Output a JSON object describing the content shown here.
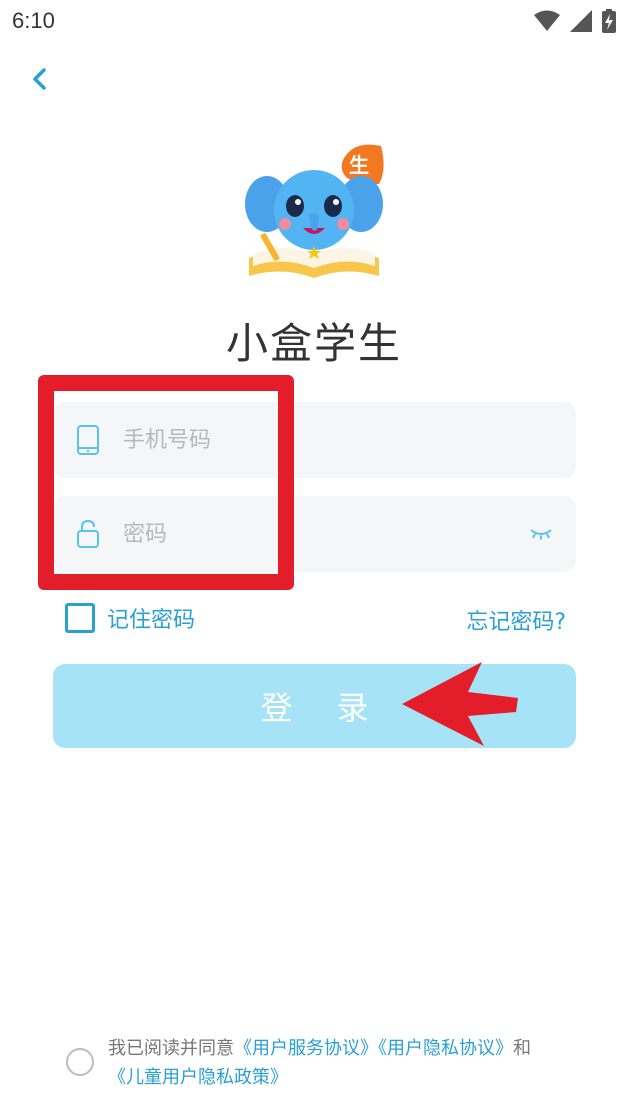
{
  "status_bar": {
    "time": "6:10"
  },
  "app": {
    "title": "小盒学生",
    "logo_badge": "生"
  },
  "form": {
    "phone_placeholder": "手机号码",
    "password_placeholder": "密码",
    "remember_label": "记住密码",
    "forgot_label": "忘记密码?",
    "login_label": "登录"
  },
  "agreement": {
    "prefix": "我已阅读并同意",
    "link_service": "《用户服务协议》",
    "link_privacy": "《用户隐私协议》",
    "conjunction": "和",
    "link_child_privacy": "《儿童用户隐私政策》"
  },
  "colors": {
    "accent": "#2a9fd6",
    "login_button": "#a6e3f7",
    "annotation_red": "#e41d2b"
  }
}
